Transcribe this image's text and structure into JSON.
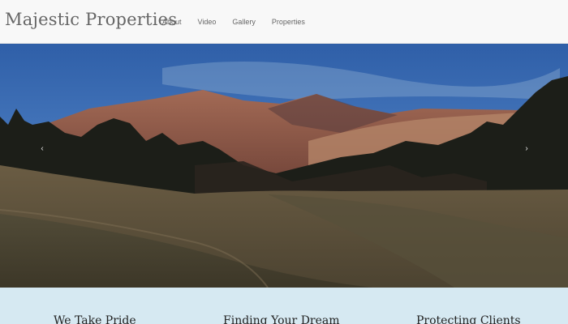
{
  "navbar": {
    "brand": "Majestic Properties",
    "links": [
      {
        "label": "About"
      },
      {
        "label": "Video"
      },
      {
        "label": "Gallery"
      },
      {
        "label": "Properties"
      }
    ]
  },
  "carousel": {
    "prev_icon": "chevron-left-icon",
    "next_icon": "chevron-right-icon",
    "prev_glyph": "‹",
    "next_glyph": "›"
  },
  "features": {
    "headings": [
      {
        "title": "We Take Pride"
      },
      {
        "title": "Finding Your Dream"
      },
      {
        "title": "Protecting Clients"
      }
    ]
  },
  "colors": {
    "feature_band": "#d6e9f2",
    "navbar_bg": "#f8f8f8"
  }
}
